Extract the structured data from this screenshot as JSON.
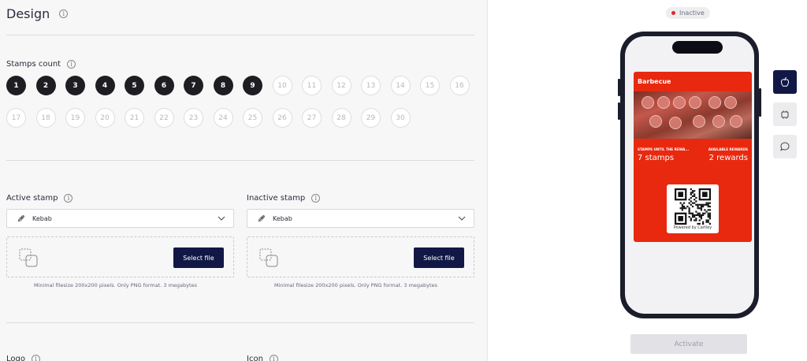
{
  "design": {
    "title": "Design",
    "info_icon": "i",
    "stamps_count_label": "Stamps count",
    "stamp_numbers": [
      "1",
      "2",
      "3",
      "4",
      "5",
      "6",
      "7",
      "8",
      "9",
      "10",
      "11",
      "12",
      "13",
      "14",
      "15",
      "16",
      "17",
      "18",
      "19",
      "20",
      "21",
      "22",
      "23",
      "24",
      "25",
      "26",
      "27",
      "28",
      "29",
      "30"
    ],
    "selected_count": 9,
    "active_stamp": {
      "label": "Active stamp",
      "select_value": "Kebab",
      "icon": "kebab-icon",
      "button_label": "Select file",
      "hint": "Minimal filesize 200x200 pixels. Only PNG format. 3 megabytes"
    },
    "inactive_stamp": {
      "label": "Inactive stamp",
      "select_value": "Kebab",
      "icon": "kebab-icon",
      "button_label": "Select file",
      "hint": "Minimal filesize 200x200 pixels. Only PNG format. 3 megabytes"
    },
    "next_labels": [
      "Logo",
      "Icon"
    ]
  },
  "preview": {
    "status": "Inactive",
    "status_color": "#e0262b",
    "card": {
      "title": "Barbecue",
      "left_label": "STAMPS UNTIL THE REWA...",
      "left_value": "7 stamps",
      "right_label": "AVAILABLE REWARDS",
      "right_value": "2 rewards",
      "powered_by": "Powered by Cartley",
      "color": "#e8290f"
    },
    "tabs": [
      "apple-icon",
      "android-icon",
      "message-icon"
    ],
    "activate_label": "Activate"
  },
  "colors": {
    "accent": "#111846",
    "stamp_active": "#1d1d22"
  }
}
